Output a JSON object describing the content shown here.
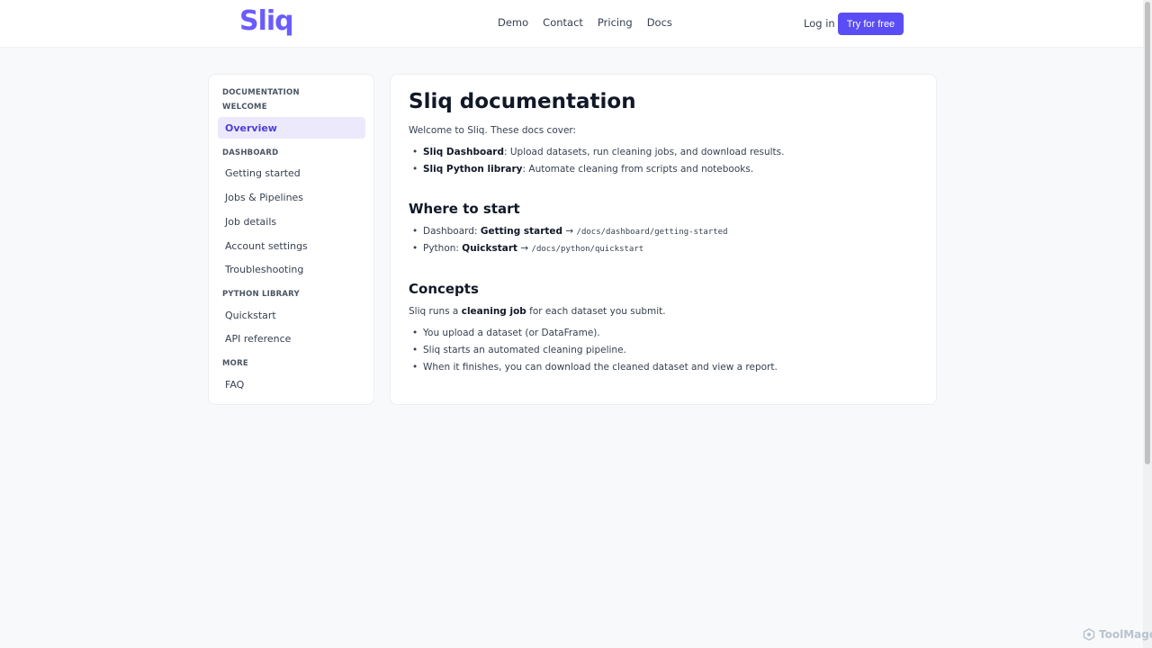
{
  "header": {
    "logo": "Sliq",
    "nav": [
      "Demo",
      "Contact",
      "Pricing",
      "Docs"
    ],
    "login": "Log in",
    "cta": "Try for free"
  },
  "sidebar": {
    "sections": [
      {
        "title": "DOCUMENTATION"
      },
      {
        "title": "WELCOME"
      },
      {
        "title": "DASHBOARD"
      },
      {
        "title": "PYTHON LIBRARY"
      },
      {
        "title": "MORE"
      }
    ],
    "items": [
      "Overview",
      "Getting started",
      "Jobs & Pipelines",
      "Job details",
      "Account settings",
      "Troubleshooting",
      "Quickstart",
      "API reference",
      "FAQ"
    ]
  },
  "main": {
    "title": "Sliq documentation",
    "intro": "Welcome to Sliq. These docs cover:",
    "cover": [
      {
        "label": "Sliq Dashboard",
        "text": ": Upload datasets, run cleaning jobs, and download results."
      },
      {
        "label": "Sliq Python library",
        "text": ": Automate cleaning from scripts and notebooks."
      }
    ],
    "where_title": "Where to start",
    "where": [
      {
        "prefix": "Dashboard: ",
        "label": "Getting started",
        "arrow": " → ",
        "path": "/docs/dashboard/getting-started"
      },
      {
        "prefix": "Python: ",
        "label": "Quickstart",
        "arrow": " → ",
        "path": "/docs/python/quickstart"
      }
    ],
    "concepts_title": "Concepts",
    "concepts_intro": {
      "pre": "Sliq runs a ",
      "bold": "cleaning job",
      "post": " for each dataset you submit."
    },
    "concepts": [
      "You upload a dataset (or DataFrame).",
      "Sliq starts an automated cleaning pipeline.",
      "When it finishes, you can download the cleaned dataset and view a report."
    ]
  },
  "watermark": "ToolMage"
}
